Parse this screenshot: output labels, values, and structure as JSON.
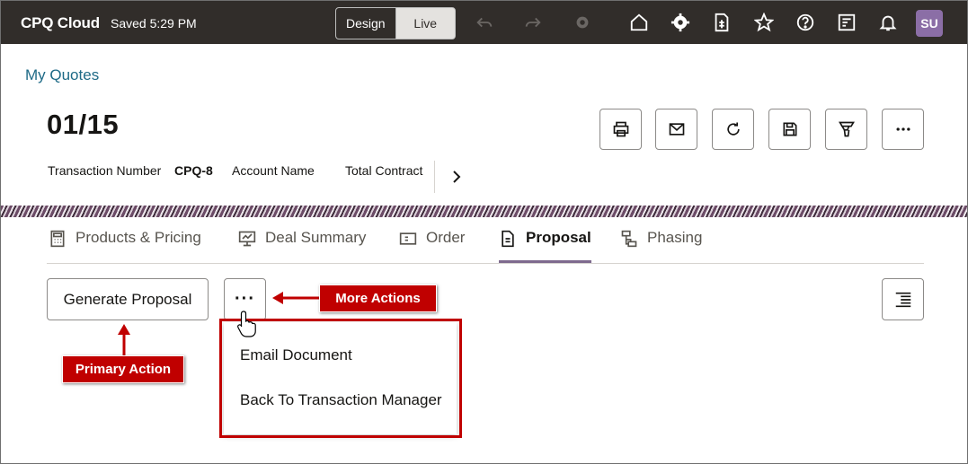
{
  "topbar": {
    "app_title": "CPQ Cloud",
    "saved_status": "Saved 5:29 PM",
    "mode_design": "Design",
    "mode_live": "Live",
    "avatar_initials": "SU"
  },
  "header": {
    "breadcrumb": "My Quotes",
    "title": "01/15",
    "transaction_number_label": "Transaction Number",
    "transaction_number_value": "CPQ-8",
    "account_name_label": "Account Name",
    "total_contract_label": "Total Contract"
  },
  "tabs": [
    {
      "label": "Products & Pricing",
      "icon": "calculator-icon"
    },
    {
      "label": "Deal Summary",
      "icon": "presentation-icon"
    },
    {
      "label": "Order",
      "icon": "order-icon"
    },
    {
      "label": "Proposal",
      "icon": "document-icon",
      "active": true
    },
    {
      "label": "Phasing",
      "icon": "hierarchy-icon"
    }
  ],
  "actions": {
    "primary_label": "Generate Proposal",
    "more_label": "···"
  },
  "menu": {
    "items": [
      "Email Document",
      "Back To Transaction Manager"
    ]
  },
  "annotations": {
    "more_actions": "More Actions",
    "primary_action": "Primary Action"
  },
  "colors": {
    "topbar_bg": "#312d2a",
    "link": "#1e6a86",
    "annotation": "#c00000",
    "avatar": "#8b6ea6",
    "active_tab_underline": "#7e6a8e"
  }
}
